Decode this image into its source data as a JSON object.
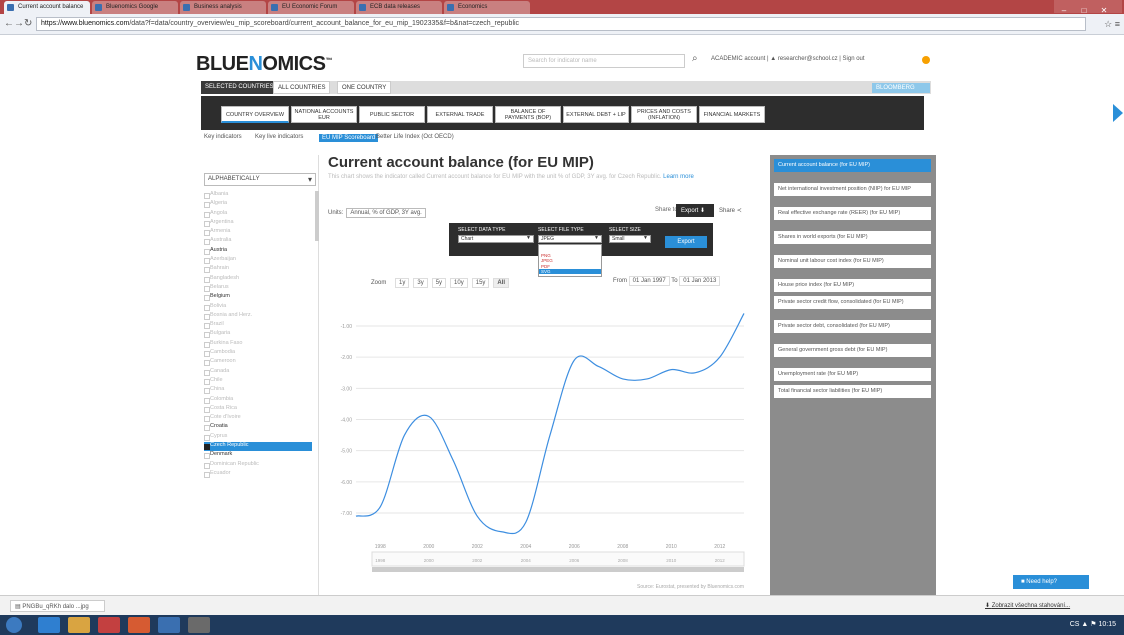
{
  "browser": {
    "tabs": [
      {
        "label": "Current account balance"
      },
      {
        "label": "Bluenomics Google"
      },
      {
        "label": "Business analysis"
      },
      {
        "label": "EU Economic Forum"
      },
      {
        "label": "ECB data releases"
      },
      {
        "label": "Economics"
      }
    ],
    "url_prefix": "https://www.bluenomics.com",
    "url_path": "/data?f=data/country_overview/eu_mip_scoreboard/current_account_balance_for_eu_mip_1902335&f=b&nat=czech_republic",
    "controls": {
      "min": "–",
      "max": "□",
      "close": "✕"
    }
  },
  "site": {
    "logo_a": "BLUE",
    "logo_o": "N",
    "logo_b": "OMICS",
    "search_placeholder": "Search for indicator name",
    "user_menu": "ACADEMIC account | ▲ researcher@school.cz | Sign out",
    "bloomberg": "BLOOMBERG"
  },
  "top_tabs": [
    "SELECTED COUNTRIES",
    "ALL COUNTRIES",
    "ONE COUNTRY"
  ],
  "categories": [
    "COUNTRY OVERVIEW",
    "NATIONAL ACCOUNTS EUR",
    "PUBLIC SECTOR",
    "EXTERNAL TRADE",
    "BALANCE OF PAYMENTS (BOP)",
    "EXTERNAL DEBT + LIP",
    "PRICES AND COSTS (INFLATION)",
    "FINANCIAL MARKETS"
  ],
  "subnav": [
    "Key indicators",
    "Key live indicators",
    "EU MIP Scoreboard",
    "Better Life Index (Oct OECD)"
  ],
  "sidebar": {
    "select": "ALPHABETICALLY",
    "countries": [
      "Albania",
      "Algeria",
      "Angola",
      "Argentina",
      "Armenia",
      "Australia",
      "Austria",
      "Azerbaijan",
      "Bahrain",
      "Bangladesh",
      "Belarus",
      "Belgium",
      "Bolivia",
      "Bosnia and Herz.",
      "Brazil",
      "Bulgaria",
      "Burkina Faso",
      "Cambodia",
      "Cameroon",
      "Canada",
      "Chile",
      "China",
      "Colombia",
      "Costa Rica",
      "Cote d'Ivoire",
      "Croatia",
      "Cyprus",
      "Czech Republic",
      "Denmark",
      "Dominican Republic",
      "Ecuador"
    ]
  },
  "main": {
    "title": "Current account balance (for EU MIP)",
    "description": "This chart shows the indicator called Current account balance for EU MIP with the unit % of GDP, 3Y avg. for Czech Republic.",
    "learn_more": "Learn more",
    "units_label": "Units:",
    "units_value": "Annual, % of GDP, 3Y avg.",
    "share_to": "Share to",
    "export": "Export",
    "share": "Share",
    "zoom_label": "Zoom",
    "zoom_options": [
      "1y",
      "3y",
      "5y",
      "10y",
      "15y",
      "All"
    ],
    "date_from_label": "From",
    "date_from": "01 Jan 1997",
    "date_to_label": "To",
    "date_to": "01 Jan 2013",
    "source": "Source: Eurostat, presented by Bluenomics.com"
  },
  "export_popup": {
    "data_type_label": "SELECT DATA TYPE",
    "data_type": "Chart",
    "file_type_label": "SELECT FILE TYPE",
    "file_type": "JPEG",
    "width_label": "SELECT SIZE",
    "width": "Small",
    "button": "Export",
    "options": [
      "PNG",
      "JPEG",
      "PDF",
      "SVG"
    ],
    "highlighted": "SVG"
  },
  "related": [
    "Current account balance (for EU MIP)",
    "Net international investment position (NIIP) for EU MIP",
    "Real effective exchange rate (REER) (for EU MIP)",
    "Shares in world exports (for EU MIP)",
    "Nominal unit labour cost index (for EU MIP)",
    "House price index (for EU MIP)",
    "Private sector credit flow, consolidated (for EU MIP)",
    "Private sector debt, consolidated (for EU MIP)",
    "General government gross debt (for EU MIP)",
    "Unemployment rate (for EU MIP)",
    "Total financial sector liabilities (for EU MIP)"
  ],
  "need_help": "Need help?",
  "download": {
    "file": "PNGBu_qRKh dalo ...jpg",
    "show_all": "Zobrazit všechna stahování..."
  },
  "tray": "CS  ▲ ⚑ 10:15",
  "colors": {
    "accent": "#2a8fd8",
    "dark": "#2d2d2d",
    "line": "#3d8ee0"
  },
  "chart_data": {
    "type": "line",
    "y_tick_labels": [
      "-1.00",
      "-2.00",
      "-3.00",
      "-4.00",
      "-5.00",
      "-6.00",
      "-7.00"
    ],
    "ylim": [
      -7.8,
      -0.2
    ],
    "xlim": [
      1997,
      2013
    ],
    "x_tick_labels": [
      "1998",
      "2000",
      "2002",
      "2004",
      "2006",
      "2008",
      "2010",
      "2012"
    ],
    "navigator_labels": [
      "1998",
      "2000",
      "2002",
      "2004",
      "2006",
      "2008",
      "2010",
      "2012"
    ],
    "series": [
      {
        "x": [
          1997,
          1998,
          1999,
          2000,
          2001,
          2002,
          2003,
          2004,
          2005,
          2006,
          2007,
          2008,
          2009,
          2010,
          2011,
          2012,
          2013
        ],
        "y": [
          -7.1,
          -6.8,
          -4.5,
          -3.9,
          -5.3,
          -7.1,
          -7.6,
          -7.3,
          -4.5,
          -2.1,
          -2.3,
          -2.7,
          -2.7,
          -2.4,
          -2.5,
          -2.0,
          -0.6
        ]
      }
    ]
  }
}
